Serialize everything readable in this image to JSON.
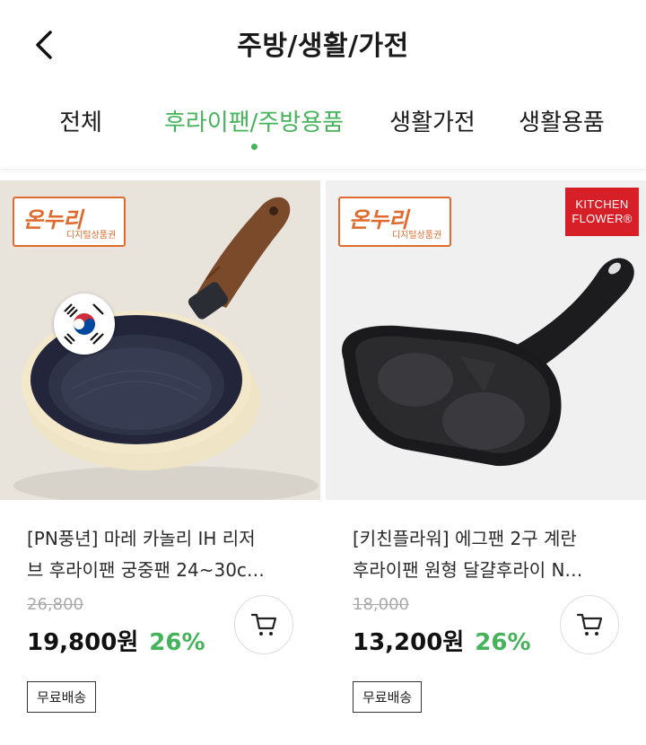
{
  "header": {
    "title": "주방/생활/가전"
  },
  "tabs": [
    {
      "label": "전체"
    },
    {
      "label": "후라이팬/주방용품"
    },
    {
      "label": "생활가전"
    },
    {
      "label": "생활용품"
    }
  ],
  "products": [
    {
      "name": "[PN풍년] 마레 카놀리 IH 리저브 후라이팬 궁중팬 24~30c…",
      "name_line1": "[PN풍년] 마레 카놀리 IH 리저",
      "name_line2": "브 후라이팬 궁중팬 24~30c…",
      "original_price": "26,800",
      "price": "19,800원",
      "discount": "26%",
      "shipping": "무료배송",
      "badge_logo": "온누리",
      "badge_sub": "디지털상품권"
    },
    {
      "name": "[키친플라워] 에그팬 2구 계란후라이팬 원형 달걀후라이 N…",
      "name_line1": "[키친플라워] 에그팬 2구 계란",
      "name_line2": "후라이팬 원형 달걀후라이 N…",
      "original_price": "18,000",
      "price": "13,200원",
      "discount": "26%",
      "shipping": "무료배송",
      "badge_logo": "온누리",
      "badge_sub": "디지털상품권",
      "brand_badge_line1": "KITCHEN",
      "brand_badge_line2": "FLOWER®"
    }
  ],
  "colors": {
    "accent": "#44b35a",
    "onnuri": "#e06a2d",
    "kitchen_flower": "#d61f26"
  },
  "icons": {
    "back": "chevron-left-icon",
    "cart": "cart-icon"
  }
}
